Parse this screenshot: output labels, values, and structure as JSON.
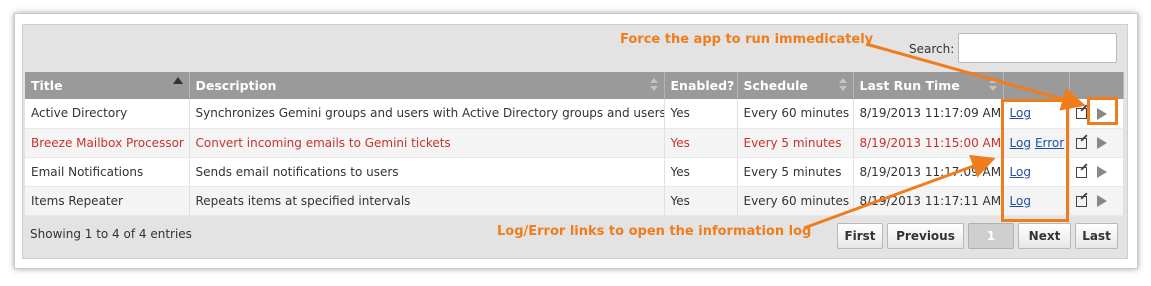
{
  "search": {
    "label": "Search:",
    "value": ""
  },
  "table": {
    "columns": [
      "Title",
      "Description",
      "Enabled?",
      "Schedule",
      "Last Run Time",
      "",
      ""
    ],
    "rows": [
      {
        "title": "Active Directory",
        "description": "Synchronizes Gemini groups and users with Active Directory groups and users",
        "enabled": "Yes",
        "schedule": "Every 60 minutes",
        "last_run": "8/19/2013 11:17:09 AM",
        "log": "Log",
        "error": ""
      },
      {
        "title": "Breeze Mailbox Processor",
        "description": "Convert incoming emails to Gemini tickets",
        "enabled": "Yes",
        "schedule": "Every 5 minutes",
        "last_run": "8/19/2013 11:15:00 AM",
        "log": "Log",
        "error": "Error"
      },
      {
        "title": "Email Notifications",
        "description": "Sends email notifications to users",
        "enabled": "Yes",
        "schedule": "Every 5 minutes",
        "last_run": "8/19/2013 11:17:09 AM",
        "log": "Log",
        "error": ""
      },
      {
        "title": "Items Repeater",
        "description": "Repeats items at specified intervals",
        "enabled": "Yes",
        "schedule": "Every 60 minutes",
        "last_run": "8/19/2013 11:17:11 AM",
        "log": "Log",
        "error": ""
      }
    ],
    "error_row_color": "#c8322e"
  },
  "info": "Showing 1 to 4 of 4 entries",
  "pagination": {
    "first": "First",
    "previous": "Previous",
    "current": "1",
    "next": "Next",
    "last": "Last"
  },
  "callouts": {
    "run": "Force the app to run immedicately",
    "log": "Log/Error links to open the information log",
    "color": "#f07d1b"
  },
  "icons": {
    "edit": "edit-icon",
    "run": "play-icon"
  }
}
